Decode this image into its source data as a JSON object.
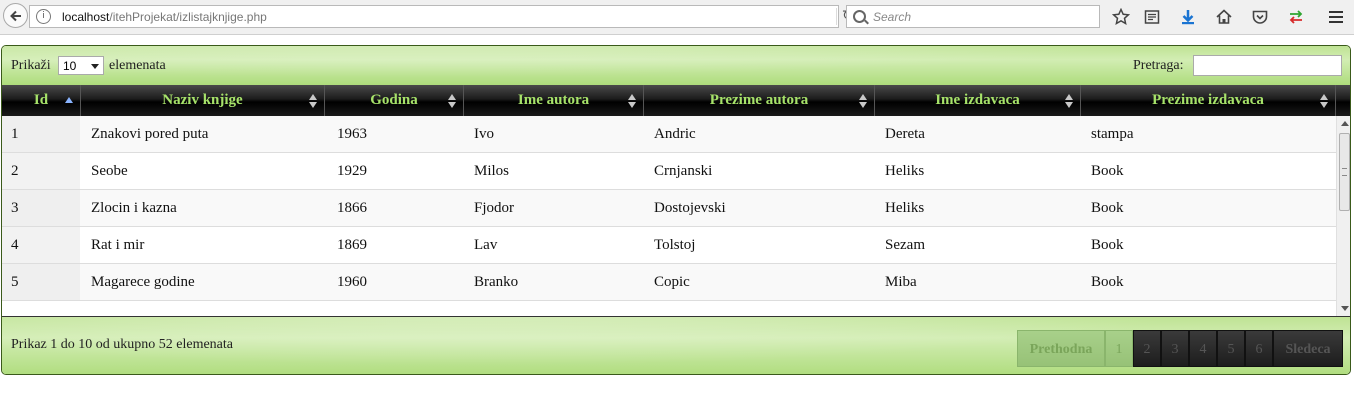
{
  "browser": {
    "url_host": "localhost",
    "url_path": "/itehProjekat/izlistajknjige.php",
    "search_placeholder": "Search"
  },
  "datatable": {
    "length_label": "Prikaži",
    "length_value": "10",
    "length_suffix": "elemenata",
    "search_label": "Pretraga:",
    "search_value": "",
    "columns": [
      "Id",
      "Naziv knjige",
      "Godina",
      "Ime autora",
      "Prezime autora",
      "Ime izdavaca",
      "Prezime izdavaca"
    ],
    "sorted_column": "Id",
    "sort_direction": "asc",
    "rows": [
      [
        "1",
        "Znakovi pored puta",
        "1963",
        "Ivo",
        "Andric",
        "Dereta",
        "stampa"
      ],
      [
        "2",
        "Seobe",
        "1929",
        "Milos",
        "Crnjanski",
        "Heliks",
        "Book"
      ],
      [
        "3",
        "Zlocin i kazna",
        "1866",
        "Fjodor",
        "Dostojevski",
        "Heliks",
        "Book"
      ],
      [
        "4",
        "Rat i mir",
        "1869",
        "Lav",
        "Tolstoj",
        "Sezam",
        "Book"
      ],
      [
        "5",
        "Magarece godine",
        "1960",
        "Branko",
        "Copic",
        "Miba",
        "Book"
      ]
    ],
    "info": "Prikaz 1 do 10 od ukupno 52 elemenata",
    "pagination": {
      "previous": "Prethodna",
      "pages": [
        "1",
        "2",
        "3",
        "4",
        "5",
        "6"
      ],
      "current_page": "1",
      "next": "Sledeca"
    }
  },
  "colors": {
    "header_green": "#bfe394",
    "column_title": "#a7e36a",
    "thead_dark": "#1c1c1c"
  }
}
